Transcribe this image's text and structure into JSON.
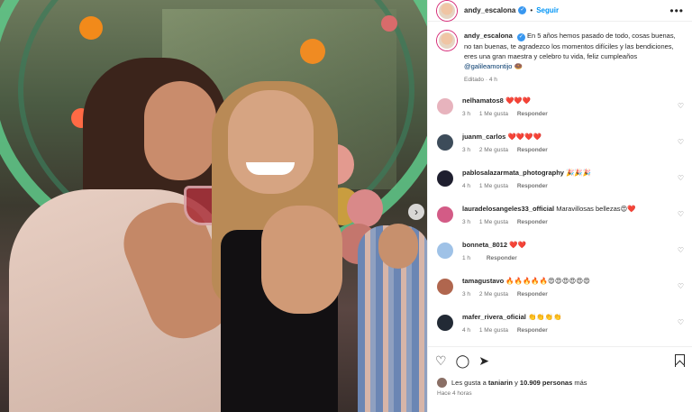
{
  "post": {
    "username": "andy_escalona",
    "follow_label": "Seguir",
    "caption_username": "andy_escalona",
    "caption_text": "En 5 años hemos pasado de todo, cosas buenas, no tan buenas, te agradezco los momentos difíciles y las bendiciones, eres una gran maestra y celebro tu vida, feliz cumpleaños",
    "caption_mention": "@galileamontijo",
    "caption_emoji": "🍩",
    "caption_meta": "Editado · 4 h",
    "likes_prefix": "Les gusta a",
    "likes_user": "taniarin",
    "likes_suffix": "y",
    "likes_count": "10.909 personas",
    "likes_tail": "más",
    "time_ago": "Hace 4 horas"
  },
  "comments": [
    {
      "user": "nelhamatos8",
      "text": "❤️❤️❤️",
      "time": "3 h",
      "likes": "1 Me gusta",
      "reply": "Responder",
      "avatar_color": "#e7b3bd"
    },
    {
      "user": "juanm_carlos",
      "text": "❤️❤️❤️❤️",
      "time": "3 h",
      "likes": "2 Me gusta",
      "reply": "Responder",
      "avatar_color": "#3d4c5a"
    },
    {
      "user": "pablosalazarmata_photography",
      "text": "🎉🎉🎉",
      "time": "4 h",
      "likes": "1 Me gusta",
      "reply": "Responder",
      "avatar_color": "#1f1f2f"
    },
    {
      "user": "lauradelosangeles33_official",
      "text": "Maravillosas bellezas😍❤️",
      "time": "3 h",
      "likes": "1 Me gusta",
      "reply": "Responder",
      "avatar_color": "#d35b86"
    },
    {
      "user": "bonneta_8012",
      "text": "❤️❤️",
      "time": "1 h",
      "likes": "",
      "reply": "Responder",
      "avatar_color": "#9fc2e7"
    },
    {
      "user": "tamagustavo",
      "text": "🔥🔥🔥🔥🔥😍😍😍😍😍😍",
      "time": "3 h",
      "likes": "2 Me gusta",
      "reply": "Responder",
      "avatar_color": "#b0664e"
    },
    {
      "user": "mafer_rivera_oficial",
      "text": "👏👏👏👏",
      "time": "4 h",
      "likes": "1 Me gusta",
      "reply": "Responder",
      "avatar_color": "#222a35"
    }
  ],
  "icons": {
    "heart": "heart-icon",
    "comment": "comment-icon",
    "share": "share-icon",
    "save": "bookmark-icon",
    "more": "more-icon",
    "next": "chevron-right-icon",
    "verified": "verified-icon"
  }
}
